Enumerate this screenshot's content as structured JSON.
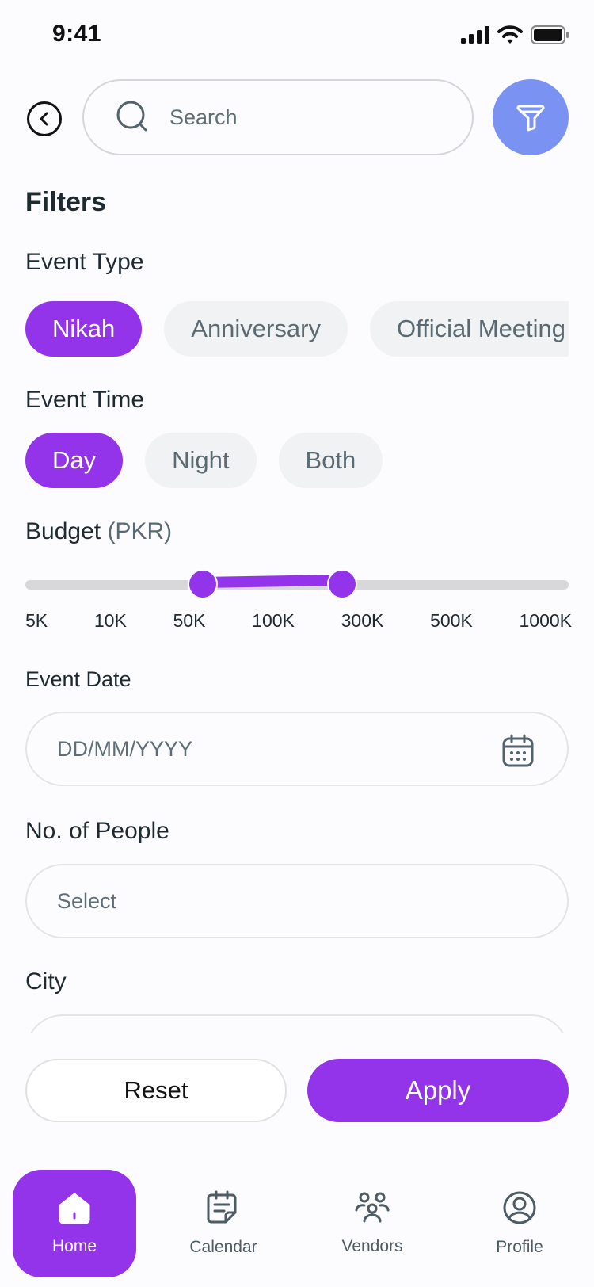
{
  "status_bar": {
    "time": "9:41"
  },
  "search": {
    "placeholder": "Search"
  },
  "filters_title": "Filters",
  "event_type": {
    "label": "Event Type",
    "chips": [
      "Nikah",
      "Anniversary",
      "Official Meeting"
    ],
    "selected": "Nikah"
  },
  "event_time": {
    "label": "Event Time",
    "chips": [
      "Day",
      "Night",
      "Both"
    ],
    "selected": "Day"
  },
  "budget": {
    "label": "Budget",
    "unit": "(PKR)",
    "ticks": [
      "5K",
      "10K",
      "50K",
      "100K",
      "300K",
      "500K",
      "1000K"
    ],
    "range_min": "50K",
    "range_max": "300K"
  },
  "event_date": {
    "label": "Event Date",
    "placeholder": "DD/MM/YYYY"
  },
  "people": {
    "label": "No. of People",
    "placeholder": "Select"
  },
  "city": {
    "label": "City"
  },
  "actions": {
    "reset": "Reset",
    "apply": "Apply"
  },
  "nav": {
    "items": [
      {
        "label": "Home",
        "icon": "home-icon",
        "active": true
      },
      {
        "label": "Calendar",
        "icon": "calendar-icon",
        "active": false
      },
      {
        "label": "Vendors",
        "icon": "vendors-icon",
        "active": false
      },
      {
        "label": "Profile",
        "icon": "profile-icon",
        "active": false
      }
    ]
  },
  "colors": {
    "accent": "#9333ea",
    "filter_button": "#7a93f3",
    "chip_inactive": "#f1f2f3"
  }
}
